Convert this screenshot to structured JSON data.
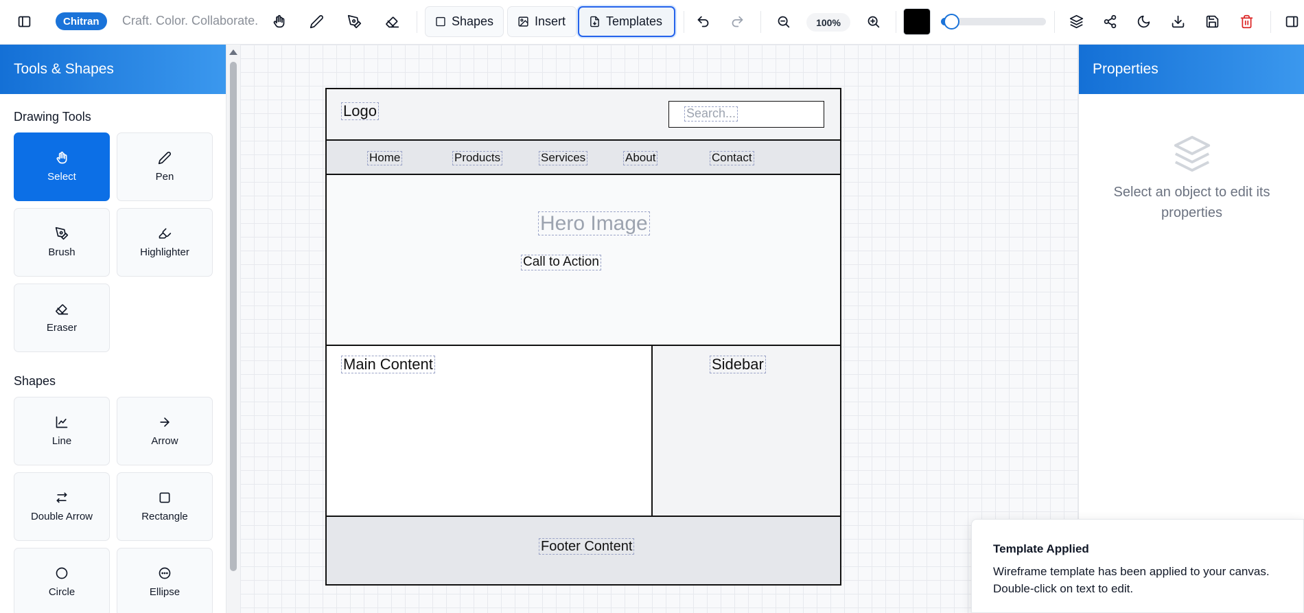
{
  "header": {
    "brand": "Chitran",
    "tagline": "Craft. Color. Collaborate.",
    "shapes_label": "Shapes",
    "insert_label": "Insert",
    "templates_label": "Templates",
    "zoom": "100%",
    "stroke_color": "#000000",
    "stroke_level": 0.1,
    "icons": [
      "sidebar-toggle-icon",
      "hand-icon",
      "pen-icon",
      "brush-icon",
      "eraser-icon",
      "undo-icon",
      "redo-icon",
      "zoom-out-icon",
      "zoom-in-icon",
      "layers-icon",
      "share-icon",
      "moon-icon",
      "download-icon",
      "save-icon",
      "trash-icon",
      "panel-right-icon"
    ]
  },
  "left_panel": {
    "title": "Tools & Shapes",
    "drawing_tools_title": "Drawing Tools",
    "drawing_tools": [
      {
        "label": "Select",
        "icon": "hand-icon",
        "selected": true
      },
      {
        "label": "Pen",
        "icon": "pen-icon"
      },
      {
        "label": "Brush",
        "icon": "brush-icon"
      },
      {
        "label": "Highlighter",
        "icon": "highlighter-icon"
      },
      {
        "label": "Eraser",
        "icon": "eraser-icon"
      }
    ],
    "shapes_title": "Shapes",
    "shapes": [
      {
        "label": "Line",
        "icon": "line-chart-icon"
      },
      {
        "label": "Arrow",
        "icon": "arrow-right-icon"
      },
      {
        "label": "Double Arrow",
        "icon": "double-arrow-icon"
      },
      {
        "label": "Rectangle",
        "icon": "square-icon"
      },
      {
        "label": "Circle",
        "icon": "circle-icon"
      },
      {
        "label": "Ellipse",
        "icon": "ellipse-icon"
      }
    ]
  },
  "canvas": {
    "logo": "Logo",
    "search_placeholder": "Search...",
    "nav": [
      "Home",
      "Products",
      "Services",
      "About",
      "Contact"
    ],
    "hero": "Hero Image",
    "cta": "Call to Action",
    "main": "Main Content",
    "sidebar": "Sidebar",
    "footer": "Footer Content"
  },
  "right_panel": {
    "title": "Properties",
    "empty_icon": "layers-icon",
    "empty_text": "Select an object to edit its properties"
  },
  "toast": {
    "title": "Template Applied",
    "message": "Wireframe template has been applied to your canvas. Double-click on text to edit."
  },
  "colors": {
    "accent": "#1a73d9",
    "danger": "#dc2626"
  }
}
